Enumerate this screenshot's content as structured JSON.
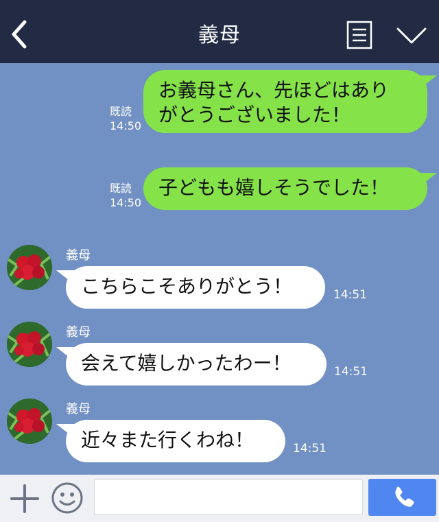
{
  "header": {
    "title": "義母",
    "icons": {
      "back": "chevron-left-icon",
      "menu": "note-list-icon",
      "expand": "chevron-down-icon"
    }
  },
  "messages": [
    {
      "side": "out",
      "text_line1": "お義母さん、先ほどはあり",
      "text_line2": "がとうございました！",
      "read": "既読",
      "time": "14:50"
    },
    {
      "side": "out",
      "text": "子どもも嬉しそうでした！",
      "read": "既読",
      "time": "14:50"
    },
    {
      "side": "in",
      "sender": "義母",
      "text": "こちらこそありがとう！",
      "time": "14:51"
    },
    {
      "side": "in",
      "sender": "義母",
      "text": "会えて嬉しかったわー！",
      "time": "14:51"
    },
    {
      "side": "in",
      "sender": "義母",
      "text": "近々また行くわね！",
      "time": "14:51"
    }
  ],
  "composer": {
    "placeholder": "",
    "icons": {
      "add": "plus-icon",
      "emoji": "smiley-icon",
      "call": "phone-icon"
    }
  },
  "colors": {
    "header_bg": "#222b43",
    "chat_bg": "#7190c3",
    "outgoing_bubble": "#85e249",
    "incoming_bubble": "#ffffff",
    "call_button": "#4f86f0"
  }
}
